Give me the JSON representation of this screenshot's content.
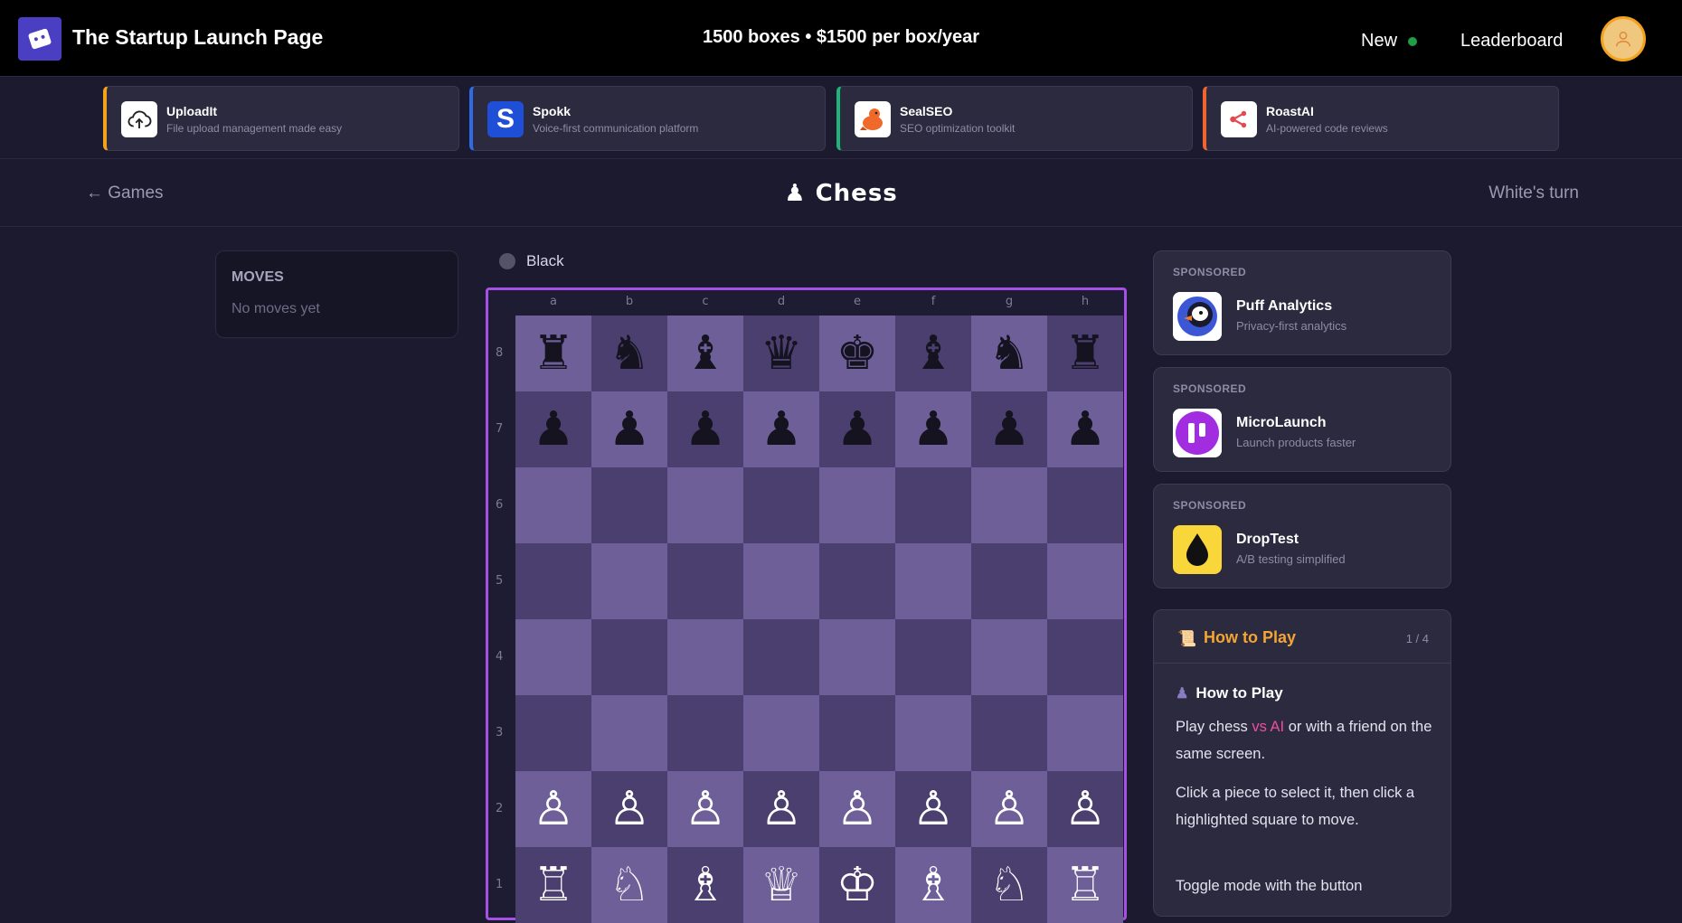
{
  "header": {
    "brand": "The Startup Launch Page",
    "pricing": "1500 boxes • $1500 per box/year",
    "nav_new": "New",
    "nav_leaderboard": "Leaderboard"
  },
  "ads": [
    {
      "name": "UploadIt",
      "desc": "File upload management made easy",
      "icon": "cloud-upload-icon",
      "accent": "#f4a21e"
    },
    {
      "name": "Spokk",
      "desc": "Voice-first communication platform",
      "icon": "spokk-s-icon",
      "accent": "#2f6be6"
    },
    {
      "name": "SealSEO",
      "desc": "SEO optimization toolkit",
      "icon": "seal-icon",
      "accent": "#1fb37a"
    },
    {
      "name": "RoastAI",
      "desc": "AI-powered code reviews",
      "icon": "share-nodes-icon",
      "accent": "#f0642e"
    }
  ],
  "game": {
    "back_label": "← Games",
    "title": "Chess",
    "turn": "White's turn"
  },
  "moves": {
    "title": "MOVES",
    "empty": "No moves yet"
  },
  "board": {
    "player_top": "Black",
    "files": [
      "a",
      "b",
      "c",
      "d",
      "e",
      "f",
      "g",
      "h"
    ],
    "ranks": [
      "8",
      "7",
      "6",
      "5",
      "4",
      "3",
      "2",
      "1"
    ],
    "position": [
      [
        "♜",
        "♞",
        "♝",
        "♛",
        "♚",
        "♝",
        "♞",
        "♜"
      ],
      [
        "♟",
        "♟",
        "♟",
        "♟",
        "♟",
        "♟",
        "♟",
        "♟"
      ],
      [
        "",
        "",
        "",
        "",
        "",
        "",
        "",
        ""
      ],
      [
        "",
        "",
        "",
        "",
        "",
        "",
        "",
        ""
      ],
      [
        "",
        "",
        "",
        "",
        "",
        "",
        "",
        ""
      ],
      [
        "",
        "",
        "",
        "",
        "",
        "",
        "",
        ""
      ],
      [
        "♙",
        "♙",
        "♙",
        "♙",
        "♙",
        "♙",
        "♙",
        "♙"
      ],
      [
        "♖",
        "♘",
        "♗",
        "♕",
        "♔",
        "♗",
        "♘",
        "♖"
      ]
    ],
    "colors": {
      "light": "#6e5f98",
      "dark": "#4a3f6e",
      "frame": "#a650e6"
    }
  },
  "sponsored": [
    {
      "tag": "SPONSORED",
      "name": "Puff Analytics",
      "desc": "Privacy-first analytics",
      "icon": "puffin-icon"
    },
    {
      "tag": "SPONSORED",
      "name": "MicroLaunch",
      "desc": "Launch products faster",
      "icon": "microlaunch-icon"
    },
    {
      "tag": "SPONSORED",
      "name": "DropTest",
      "desc": "A/B testing simplified",
      "icon": "drop-icon"
    }
  ],
  "howto": {
    "title": "How to Play",
    "page": "1 / 4",
    "subtitle": "How to Play",
    "p1_a": "Play chess ",
    "p1_highlight": "vs AI",
    "p1_b": " or with a friend on the same screen.",
    "p2": "Click a piece to select it, then click a highlighted square to move.",
    "p3": "Toggle mode with the button"
  }
}
